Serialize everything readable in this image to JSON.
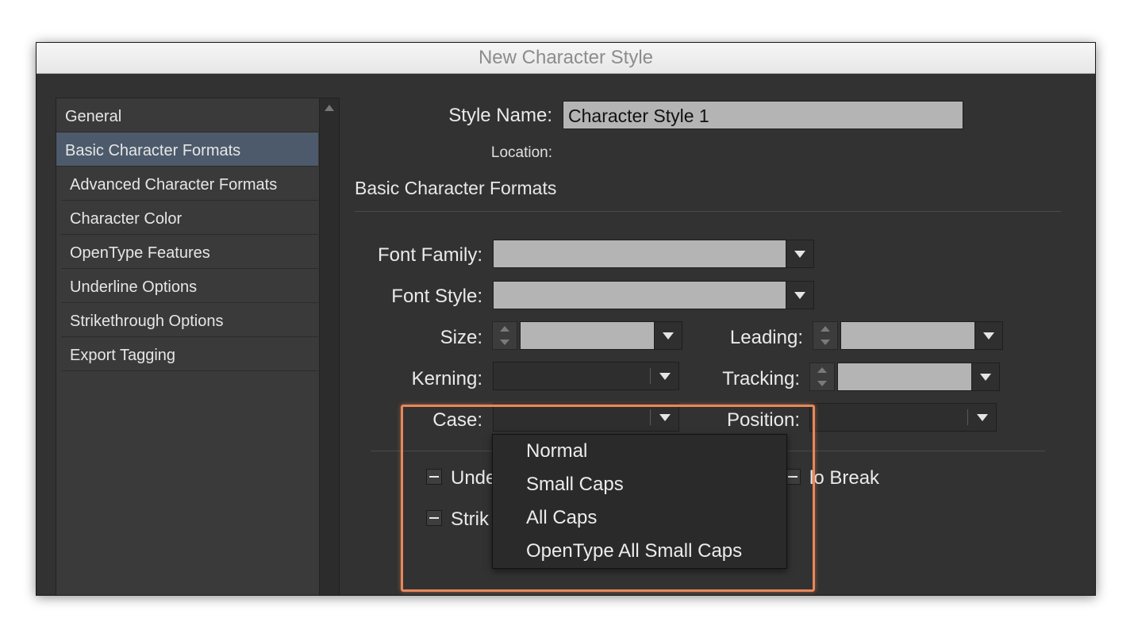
{
  "window": {
    "title": "New Character Style"
  },
  "sidebar": {
    "items": [
      {
        "label": "General"
      },
      {
        "label": "Basic Character Formats"
      },
      {
        "label": "Advanced Character Formats"
      },
      {
        "label": "Character Color"
      },
      {
        "label": "OpenType Features"
      },
      {
        "label": "Underline Options"
      },
      {
        "label": "Strikethrough Options"
      },
      {
        "label": "Export Tagging"
      }
    ],
    "selected_index": 1
  },
  "header": {
    "style_name_label": "Style Name:",
    "style_name_value": "Character Style 1",
    "location_label": "Location:",
    "section_title": "Basic Character Formats"
  },
  "form": {
    "font_family_label": "Font Family:",
    "font_style_label": "Font Style:",
    "size_label": "Size:",
    "leading_label": "Leading:",
    "kerning_label": "Kerning:",
    "tracking_label": "Tracking:",
    "case_label": "Case:",
    "position_label": "Position:"
  },
  "checkboxes": {
    "underline_partial": "Unde",
    "strikethrough_partial": "Strik",
    "no_break_partial": "lo Break"
  },
  "case_menu": {
    "options": [
      "Normal",
      "Small Caps",
      "All Caps",
      "OpenType All Small Caps"
    ]
  },
  "colors": {
    "dialog_bg": "#323232",
    "selected_item": "#4c5a6b",
    "highlight_border": "#e8875a"
  }
}
